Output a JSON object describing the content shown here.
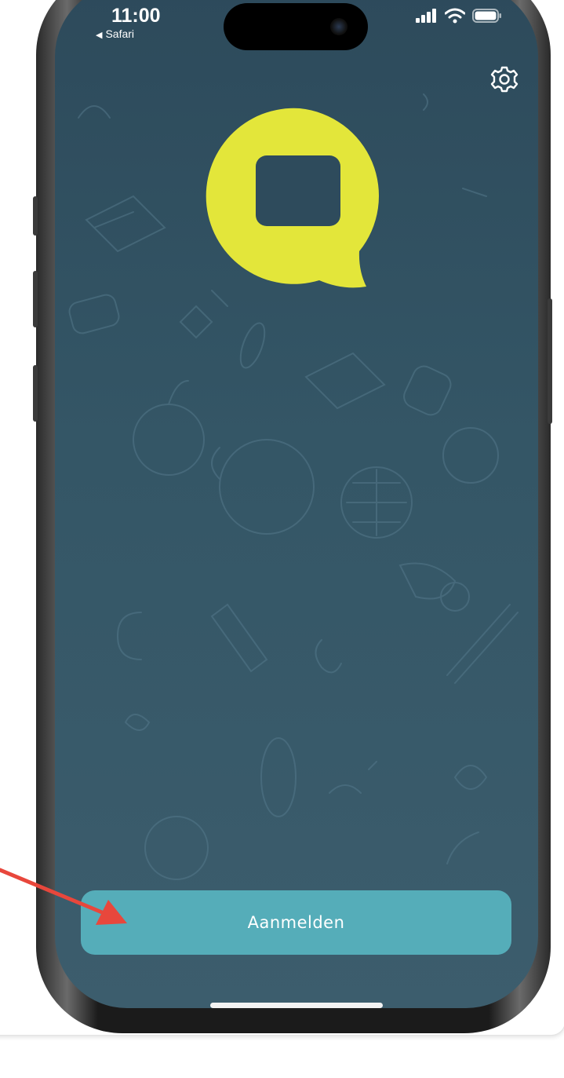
{
  "status_bar": {
    "time": "11:00",
    "back_app": "Safari",
    "icons": [
      "cellular-signal-icon",
      "wifi-icon",
      "battery-icon"
    ]
  },
  "toolbar": {
    "settings_icon": "gear-icon"
  },
  "logo": {
    "name": "speech-bubble-logo",
    "color": "#e3e63a"
  },
  "main": {
    "login_label": "Aanmelden",
    "login_color": "#55adb9"
  },
  "background_color": "#345666",
  "annotation": {
    "arrow_color": "#e8473c"
  }
}
